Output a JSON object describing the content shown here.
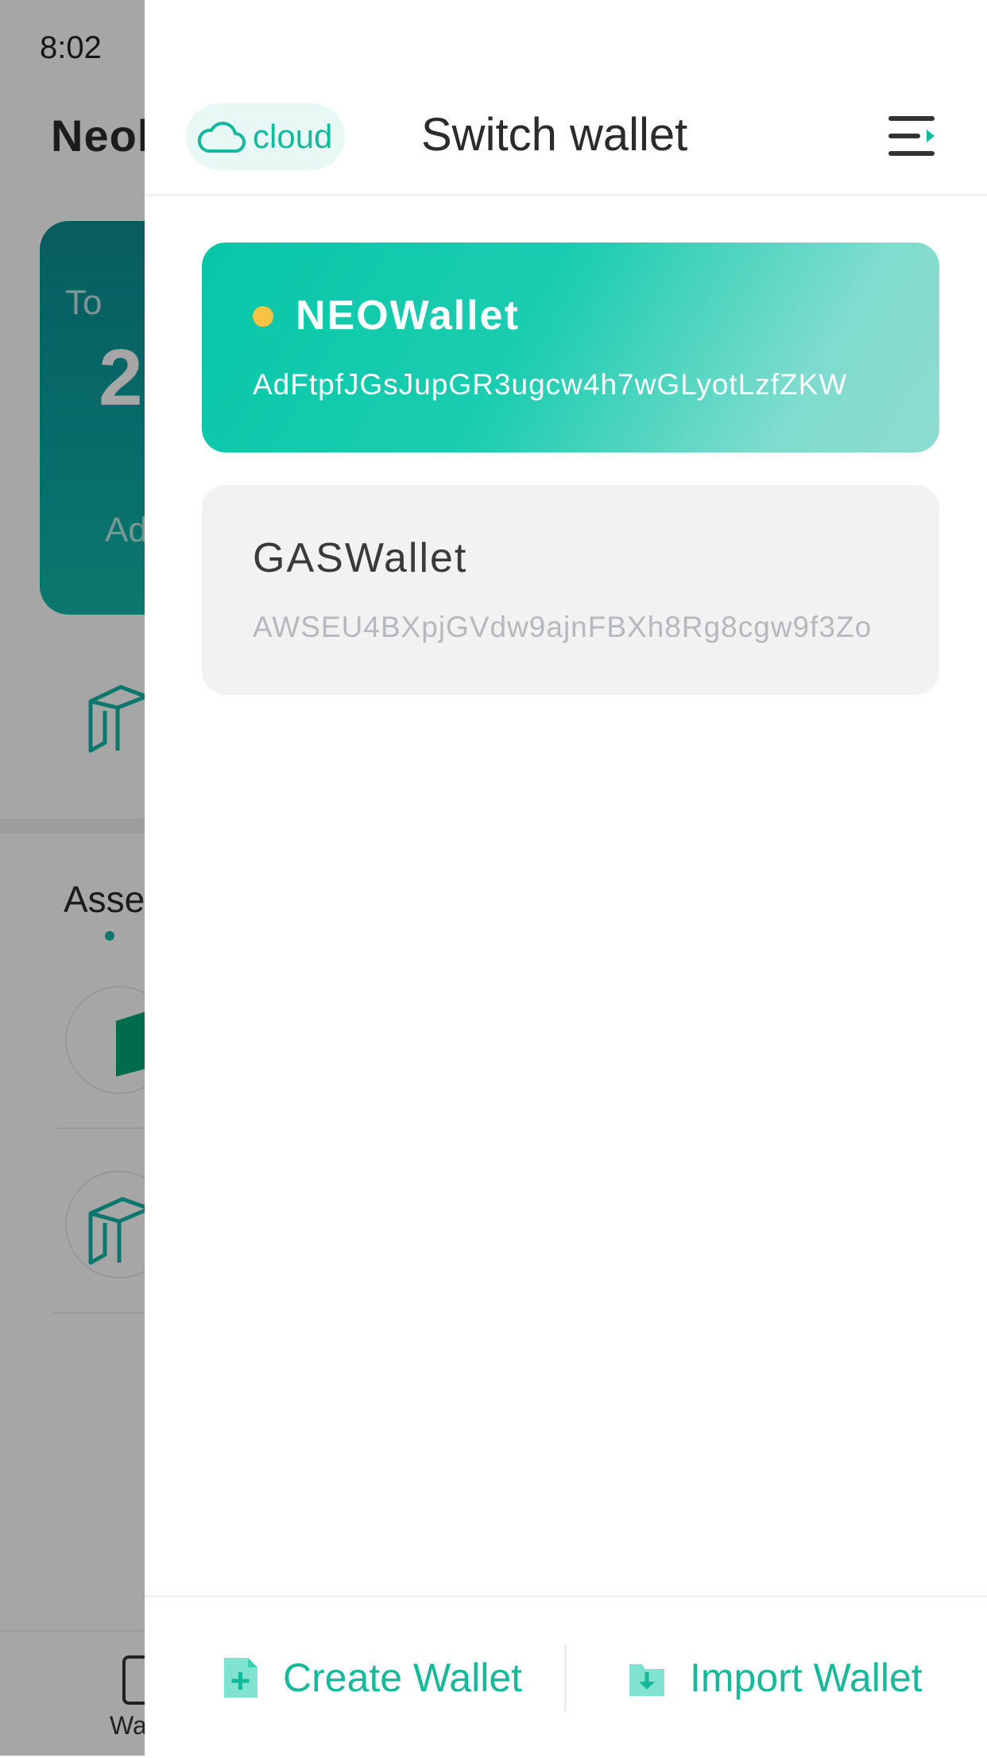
{
  "status_bar": {
    "time": "8:02"
  },
  "background_app": {
    "title": "Neol",
    "total_card": {
      "label": "To",
      "value": "2",
      "address_label": "Ad"
    },
    "assets_title": "Asse",
    "tab_label": "Wa"
  },
  "drawer": {
    "cloud_button": {
      "label": "cloud",
      "icon": "cloud-icon"
    },
    "title": "Switch wallet",
    "menu_icon": "collapse-menu-icon",
    "wallets": [
      {
        "name": "NEOWallet",
        "address": "AdFtpfJGsJupGR3ugcw4h7wGLyotLzfZKW",
        "active": true
      },
      {
        "name": "GASWallet",
        "address": "AWSEU4BXpjGVdw9ajnFBXh8Rg8cgw9f3Zo",
        "active": false
      }
    ],
    "footer": {
      "create_label": "Create Wallet",
      "import_label": "Import Wallet"
    }
  },
  "colors": {
    "accent": "#13b99a",
    "active_dot": "#f7c343",
    "card_gradient_start": "#07c6a8",
    "card_gradient_end": "#8edbd0"
  }
}
